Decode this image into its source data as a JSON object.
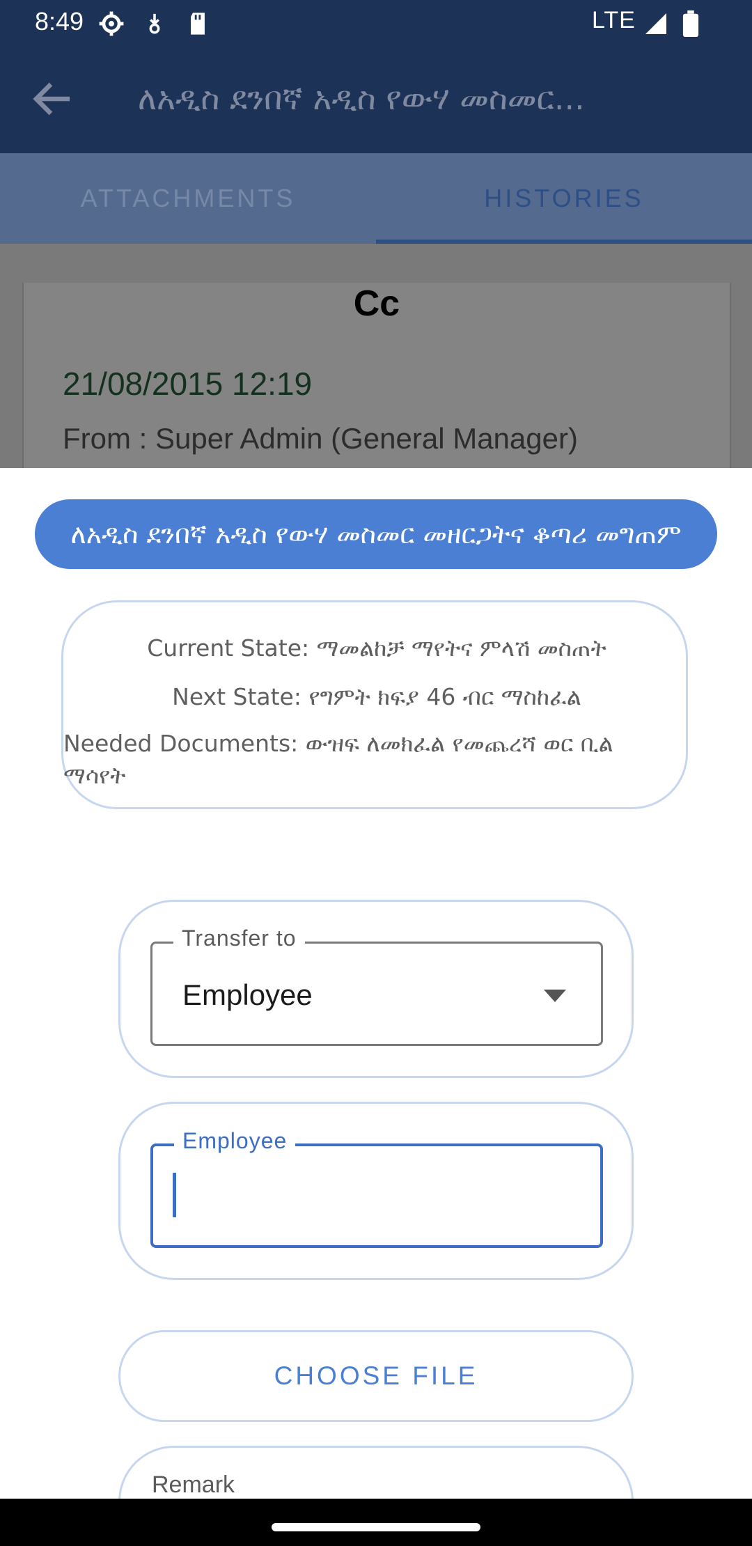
{
  "status_bar": {
    "time": "8:49",
    "network": "LTE"
  },
  "app_bar": {
    "title": "ለአዲስ ደንበኛ አዲስ የውሃ መስመር..."
  },
  "tabs": [
    {
      "label": "ATTACHMENTS",
      "selected": false
    },
    {
      "label": "HISTORIES",
      "selected": true
    }
  ],
  "history_card": {
    "title": "Cc",
    "date": "21/08/2015 12:19",
    "from": "From : Super Admin (General Manager)"
  },
  "sheet": {
    "title": "ለአዲስ ደንበኛ አዲስ የውሃ መስመር መዘርጋትና ቆጣሪ መግጠም",
    "current_state": "Current State: ማመልከቻ ማየትና ምላሽ መስጠት",
    "next_state": "Next State: የግምት ክፍያ 46 ብር ማስከፈል",
    "needed_documents": "Needed Documents: ውዝፍ ለመክፈል የመጨረሻ ወር  ቢል ማሳየት",
    "transfer_to": {
      "label": "Transfer to",
      "value": "Employee"
    },
    "employee_field": {
      "label": "Employee",
      "value": ""
    },
    "choose_file_label": "CHOOSE FILE",
    "remark_label": "Remark"
  },
  "colors": {
    "primary_dark": "#1d3257",
    "accent": "#4a7fd4",
    "focus": "#3d6dc4",
    "pill_border": "#c6d6ef"
  },
  "icons": {
    "back": "arrow-left-icon",
    "dropdown": "caret-down-icon"
  }
}
